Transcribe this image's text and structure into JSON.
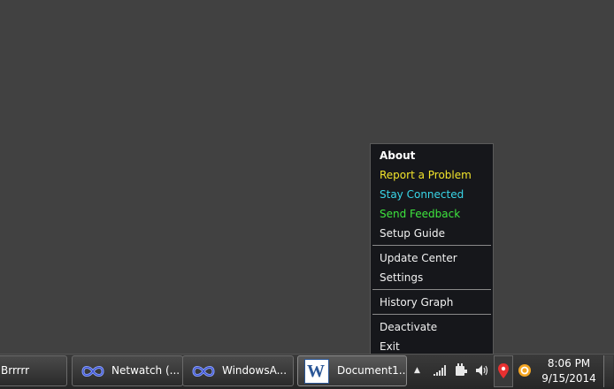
{
  "context_menu": {
    "items": [
      {
        "label": "About",
        "color": "#ffffff"
      },
      {
        "label": "Report a Problem",
        "color": "#f3e52b"
      },
      {
        "label": "Stay Connected",
        "color": "#39d6e8"
      },
      {
        "label": "Send Feedback",
        "color": "#3ee63e"
      },
      {
        "label": "Setup Guide",
        "color": "#f2f2f2"
      },
      {
        "label": "Update Center",
        "color": "#f2f2f2"
      },
      {
        "label": "Settings",
        "color": "#f2f2f2"
      },
      {
        "label": "History Graph",
        "color": "#f2f2f2"
      },
      {
        "label": "Deactivate",
        "color": "#f2f2f2"
      },
      {
        "label": "Exit",
        "color": "#f2f2f2"
      }
    ]
  },
  "taskbar": {
    "buttons": [
      {
        "label": "Brrrrr",
        "icon": "none"
      },
      {
        "label": "Netwatch (...",
        "icon": "infinity-icon"
      },
      {
        "label": "WindowsA...",
        "icon": "infinity-icon"
      },
      {
        "label": "Document1...",
        "icon": "word-icon"
      }
    ],
    "word_icon_letter": "W"
  },
  "tray": {
    "icons": [
      "show-hidden-icons-arrow",
      "network-signal-icon",
      "power-plug-icon",
      "volume-icon",
      "location-pin-icon",
      "orange-app-icon"
    ],
    "time": "8:06 PM",
    "date": "9/15/2014"
  }
}
